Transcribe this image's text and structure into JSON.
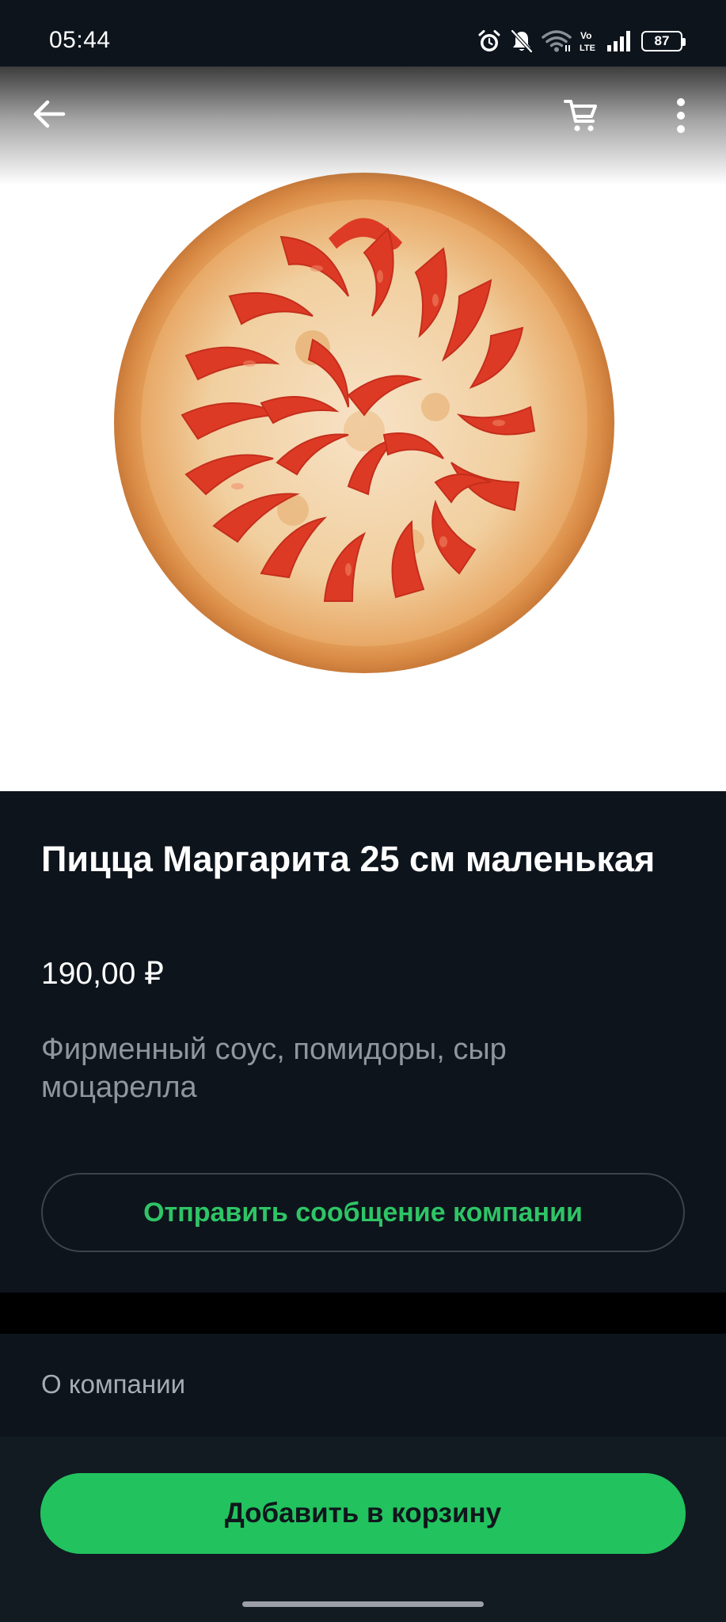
{
  "status_bar": {
    "time": "05:44",
    "battery": "87",
    "network_label": "Vo LTE",
    "icons": [
      "alarm-icon",
      "bell-off-icon",
      "wifi-icon",
      "volte-icon",
      "signal-icon",
      "battery-icon"
    ]
  },
  "toolbar": {
    "back_icon": "arrow-left-icon",
    "cart_icon": "cart-icon",
    "more_icon": "more-vertical-icon"
  },
  "product": {
    "image_name": "pizza-margherita-photo",
    "title": "Пицца Маргарита 25 см маленькая",
    "price": "190,00 ₽",
    "description": "Фирменный соус, помидоры, сыр моцарелла",
    "message_button": "Отправить сообщение компании"
  },
  "about": {
    "label": "О компании"
  },
  "bottom": {
    "add_to_cart": "Добавить в корзину"
  },
  "colors": {
    "background": "#0d141c",
    "accent_green": "#22c35e",
    "message_text_green": "#2fc466",
    "muted_text": "#8f969e"
  }
}
